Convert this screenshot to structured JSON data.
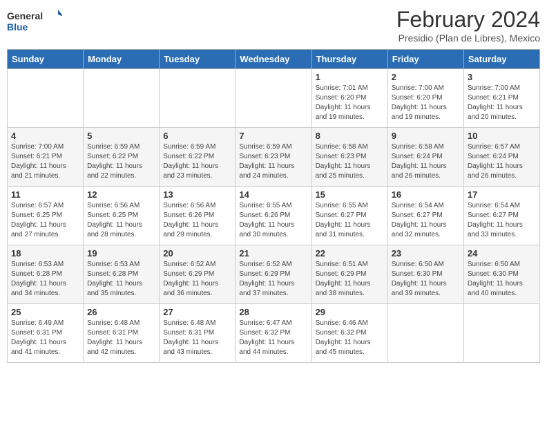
{
  "header": {
    "logo_general": "General",
    "logo_blue": "Blue",
    "title": "February 2024",
    "subtitle": "Presidio (Plan de Libres), Mexico"
  },
  "days_of_week": [
    "Sunday",
    "Monday",
    "Tuesday",
    "Wednesday",
    "Thursday",
    "Friday",
    "Saturday"
  ],
  "weeks": [
    [
      {
        "day": "",
        "info": ""
      },
      {
        "day": "",
        "info": ""
      },
      {
        "day": "",
        "info": ""
      },
      {
        "day": "",
        "info": ""
      },
      {
        "day": "1",
        "info": "Sunrise: 7:01 AM\nSunset: 6:20 PM\nDaylight: 11 hours and 19 minutes."
      },
      {
        "day": "2",
        "info": "Sunrise: 7:00 AM\nSunset: 6:20 PM\nDaylight: 11 hours and 19 minutes."
      },
      {
        "day": "3",
        "info": "Sunrise: 7:00 AM\nSunset: 6:21 PM\nDaylight: 11 hours and 20 minutes."
      }
    ],
    [
      {
        "day": "4",
        "info": "Sunrise: 7:00 AM\nSunset: 6:21 PM\nDaylight: 11 hours and 21 minutes."
      },
      {
        "day": "5",
        "info": "Sunrise: 6:59 AM\nSunset: 6:22 PM\nDaylight: 11 hours and 22 minutes."
      },
      {
        "day": "6",
        "info": "Sunrise: 6:59 AM\nSunset: 6:22 PM\nDaylight: 11 hours and 23 minutes."
      },
      {
        "day": "7",
        "info": "Sunrise: 6:59 AM\nSunset: 6:23 PM\nDaylight: 11 hours and 24 minutes."
      },
      {
        "day": "8",
        "info": "Sunrise: 6:58 AM\nSunset: 6:23 PM\nDaylight: 11 hours and 25 minutes."
      },
      {
        "day": "9",
        "info": "Sunrise: 6:58 AM\nSunset: 6:24 PM\nDaylight: 11 hours and 26 minutes."
      },
      {
        "day": "10",
        "info": "Sunrise: 6:57 AM\nSunset: 6:24 PM\nDaylight: 11 hours and 26 minutes."
      }
    ],
    [
      {
        "day": "11",
        "info": "Sunrise: 6:57 AM\nSunset: 6:25 PM\nDaylight: 11 hours and 27 minutes."
      },
      {
        "day": "12",
        "info": "Sunrise: 6:56 AM\nSunset: 6:25 PM\nDaylight: 11 hours and 28 minutes."
      },
      {
        "day": "13",
        "info": "Sunrise: 6:56 AM\nSunset: 6:26 PM\nDaylight: 11 hours and 29 minutes."
      },
      {
        "day": "14",
        "info": "Sunrise: 6:55 AM\nSunset: 6:26 PM\nDaylight: 11 hours and 30 minutes."
      },
      {
        "day": "15",
        "info": "Sunrise: 6:55 AM\nSunset: 6:27 PM\nDaylight: 11 hours and 31 minutes."
      },
      {
        "day": "16",
        "info": "Sunrise: 6:54 AM\nSunset: 6:27 PM\nDaylight: 11 hours and 32 minutes."
      },
      {
        "day": "17",
        "info": "Sunrise: 6:54 AM\nSunset: 6:27 PM\nDaylight: 11 hours and 33 minutes."
      }
    ],
    [
      {
        "day": "18",
        "info": "Sunrise: 6:53 AM\nSunset: 6:28 PM\nDaylight: 11 hours and 34 minutes."
      },
      {
        "day": "19",
        "info": "Sunrise: 6:53 AM\nSunset: 6:28 PM\nDaylight: 11 hours and 35 minutes."
      },
      {
        "day": "20",
        "info": "Sunrise: 6:52 AM\nSunset: 6:29 PM\nDaylight: 11 hours and 36 minutes."
      },
      {
        "day": "21",
        "info": "Sunrise: 6:52 AM\nSunset: 6:29 PM\nDaylight: 11 hours and 37 minutes."
      },
      {
        "day": "22",
        "info": "Sunrise: 6:51 AM\nSunset: 6:29 PM\nDaylight: 11 hours and 38 minutes."
      },
      {
        "day": "23",
        "info": "Sunrise: 6:50 AM\nSunset: 6:30 PM\nDaylight: 11 hours and 39 minutes."
      },
      {
        "day": "24",
        "info": "Sunrise: 6:50 AM\nSunset: 6:30 PM\nDaylight: 11 hours and 40 minutes."
      }
    ],
    [
      {
        "day": "25",
        "info": "Sunrise: 6:49 AM\nSunset: 6:31 PM\nDaylight: 11 hours and 41 minutes."
      },
      {
        "day": "26",
        "info": "Sunrise: 6:48 AM\nSunset: 6:31 PM\nDaylight: 11 hours and 42 minutes."
      },
      {
        "day": "27",
        "info": "Sunrise: 6:48 AM\nSunset: 6:31 PM\nDaylight: 11 hours and 43 minutes."
      },
      {
        "day": "28",
        "info": "Sunrise: 6:47 AM\nSunset: 6:32 PM\nDaylight: 11 hours and 44 minutes."
      },
      {
        "day": "29",
        "info": "Sunrise: 6:46 AM\nSunset: 6:32 PM\nDaylight: 11 hours and 45 minutes."
      },
      {
        "day": "",
        "info": ""
      },
      {
        "day": "",
        "info": ""
      }
    ]
  ]
}
